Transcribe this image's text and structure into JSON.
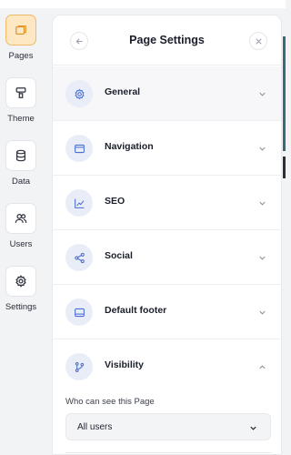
{
  "rail": {
    "items": [
      {
        "label": "Pages",
        "icon": "pages-icon",
        "active": true
      },
      {
        "label": "Theme",
        "icon": "paint-roller-icon",
        "active": false
      },
      {
        "label": "Data",
        "icon": "database-icon",
        "active": false
      },
      {
        "label": "Users",
        "icon": "users-icon",
        "active": false
      },
      {
        "label": "Settings",
        "icon": "settings-icon",
        "active": false
      }
    ]
  },
  "panel": {
    "title": "Page Settings",
    "sections": [
      {
        "label": "General",
        "icon": "general-icon",
        "expanded": false
      },
      {
        "label": "Navigation",
        "icon": "navigation-icon",
        "expanded": false
      },
      {
        "label": "SEO",
        "icon": "seo-icon",
        "expanded": false
      },
      {
        "label": "Social",
        "icon": "share-icon",
        "expanded": false
      },
      {
        "label": "Default footer",
        "icon": "footer-icon",
        "expanded": false
      },
      {
        "label": "Visibility",
        "icon": "branch-icon",
        "expanded": true
      }
    ],
    "visibility": {
      "field_label": "Who can see this Page",
      "selected": "All users"
    }
  },
  "colors": {
    "accent_bg": "#fde8c3",
    "accent_border": "#f2b968",
    "icon_circle": "#e9edf7",
    "icon_stroke": "#4a6fd0"
  }
}
